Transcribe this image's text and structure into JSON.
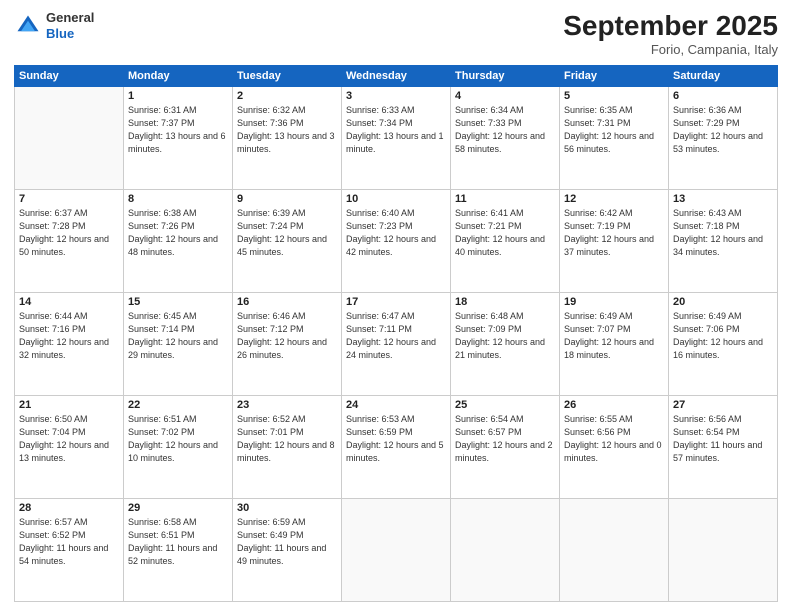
{
  "header": {
    "logo_line1": "General",
    "logo_line2": "Blue",
    "title": "September 2025",
    "subtitle": "Forio, Campania, Italy"
  },
  "weekdays": [
    "Sunday",
    "Monday",
    "Tuesday",
    "Wednesday",
    "Thursday",
    "Friday",
    "Saturday"
  ],
  "weeks": [
    [
      {
        "day": "",
        "sunrise": "",
        "sunset": "",
        "daylight": ""
      },
      {
        "day": "1",
        "sunrise": "6:31 AM",
        "sunset": "7:37 PM",
        "daylight": "13 hours and 6 minutes."
      },
      {
        "day": "2",
        "sunrise": "6:32 AM",
        "sunset": "7:36 PM",
        "daylight": "13 hours and 3 minutes."
      },
      {
        "day": "3",
        "sunrise": "6:33 AM",
        "sunset": "7:34 PM",
        "daylight": "13 hours and 1 minute."
      },
      {
        "day": "4",
        "sunrise": "6:34 AM",
        "sunset": "7:33 PM",
        "daylight": "12 hours and 58 minutes."
      },
      {
        "day": "5",
        "sunrise": "6:35 AM",
        "sunset": "7:31 PM",
        "daylight": "12 hours and 56 minutes."
      },
      {
        "day": "6",
        "sunrise": "6:36 AM",
        "sunset": "7:29 PM",
        "daylight": "12 hours and 53 minutes."
      }
    ],
    [
      {
        "day": "7",
        "sunrise": "6:37 AM",
        "sunset": "7:28 PM",
        "daylight": "12 hours and 50 minutes."
      },
      {
        "day": "8",
        "sunrise": "6:38 AM",
        "sunset": "7:26 PM",
        "daylight": "12 hours and 48 minutes."
      },
      {
        "day": "9",
        "sunrise": "6:39 AM",
        "sunset": "7:24 PM",
        "daylight": "12 hours and 45 minutes."
      },
      {
        "day": "10",
        "sunrise": "6:40 AM",
        "sunset": "7:23 PM",
        "daylight": "12 hours and 42 minutes."
      },
      {
        "day": "11",
        "sunrise": "6:41 AM",
        "sunset": "7:21 PM",
        "daylight": "12 hours and 40 minutes."
      },
      {
        "day": "12",
        "sunrise": "6:42 AM",
        "sunset": "7:19 PM",
        "daylight": "12 hours and 37 minutes."
      },
      {
        "day": "13",
        "sunrise": "6:43 AM",
        "sunset": "7:18 PM",
        "daylight": "12 hours and 34 minutes."
      }
    ],
    [
      {
        "day": "14",
        "sunrise": "6:44 AM",
        "sunset": "7:16 PM",
        "daylight": "12 hours and 32 minutes."
      },
      {
        "day": "15",
        "sunrise": "6:45 AM",
        "sunset": "7:14 PM",
        "daylight": "12 hours and 29 minutes."
      },
      {
        "day": "16",
        "sunrise": "6:46 AM",
        "sunset": "7:12 PM",
        "daylight": "12 hours and 26 minutes."
      },
      {
        "day": "17",
        "sunrise": "6:47 AM",
        "sunset": "7:11 PM",
        "daylight": "12 hours and 24 minutes."
      },
      {
        "day": "18",
        "sunrise": "6:48 AM",
        "sunset": "7:09 PM",
        "daylight": "12 hours and 21 minutes."
      },
      {
        "day": "19",
        "sunrise": "6:49 AM",
        "sunset": "7:07 PM",
        "daylight": "12 hours and 18 minutes."
      },
      {
        "day": "20",
        "sunrise": "6:49 AM",
        "sunset": "7:06 PM",
        "daylight": "12 hours and 16 minutes."
      }
    ],
    [
      {
        "day": "21",
        "sunrise": "6:50 AM",
        "sunset": "7:04 PM",
        "daylight": "12 hours and 13 minutes."
      },
      {
        "day": "22",
        "sunrise": "6:51 AM",
        "sunset": "7:02 PM",
        "daylight": "12 hours and 10 minutes."
      },
      {
        "day": "23",
        "sunrise": "6:52 AM",
        "sunset": "7:01 PM",
        "daylight": "12 hours and 8 minutes."
      },
      {
        "day": "24",
        "sunrise": "6:53 AM",
        "sunset": "6:59 PM",
        "daylight": "12 hours and 5 minutes."
      },
      {
        "day": "25",
        "sunrise": "6:54 AM",
        "sunset": "6:57 PM",
        "daylight": "12 hours and 2 minutes."
      },
      {
        "day": "26",
        "sunrise": "6:55 AM",
        "sunset": "6:56 PM",
        "daylight": "12 hours and 0 minutes."
      },
      {
        "day": "27",
        "sunrise": "6:56 AM",
        "sunset": "6:54 PM",
        "daylight": "11 hours and 57 minutes."
      }
    ],
    [
      {
        "day": "28",
        "sunrise": "6:57 AM",
        "sunset": "6:52 PM",
        "daylight": "11 hours and 54 minutes."
      },
      {
        "day": "29",
        "sunrise": "6:58 AM",
        "sunset": "6:51 PM",
        "daylight": "11 hours and 52 minutes."
      },
      {
        "day": "30",
        "sunrise": "6:59 AM",
        "sunset": "6:49 PM",
        "daylight": "11 hours and 49 minutes."
      },
      {
        "day": "",
        "sunrise": "",
        "sunset": "",
        "daylight": ""
      },
      {
        "day": "",
        "sunrise": "",
        "sunset": "",
        "daylight": ""
      },
      {
        "day": "",
        "sunrise": "",
        "sunset": "",
        "daylight": ""
      },
      {
        "day": "",
        "sunrise": "",
        "sunset": "",
        "daylight": ""
      }
    ]
  ]
}
